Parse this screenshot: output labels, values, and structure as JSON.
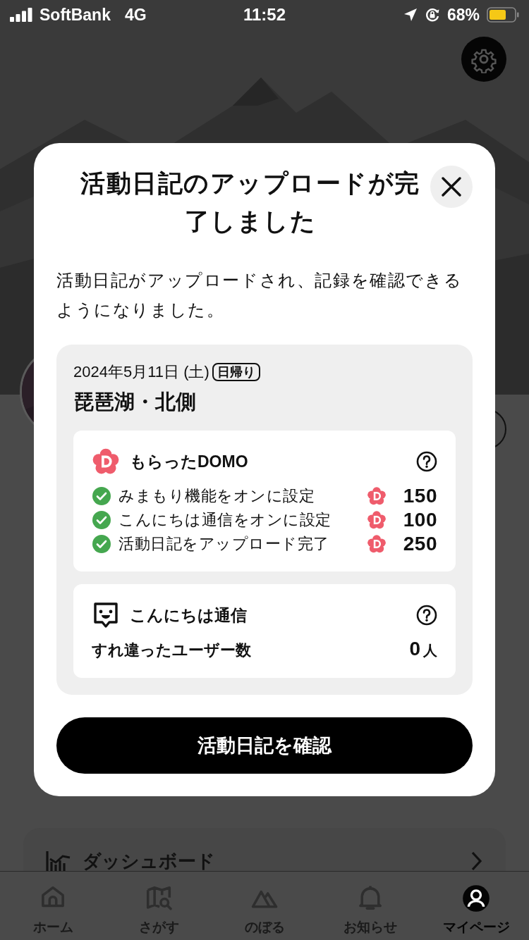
{
  "status_bar": {
    "carrier": "SoftBank",
    "network": "4G",
    "time": "11:52",
    "battery": "68%"
  },
  "background": {
    "dashboard_label": "ダッシュボード"
  },
  "dialog": {
    "title": "活動日記のアップロードが完了しました",
    "message": "活動日記がアップロードされ、記録を確認できるようになりました。",
    "summary": {
      "date": "2024年5月11日 (土)",
      "trip_type": "日帰り",
      "place": "琵琶湖・北側",
      "domo": {
        "title": "もらったDOMO",
        "items": [
          {
            "label": "みまもり機能をオンに設定",
            "checked": true,
            "points": "150"
          },
          {
            "label": "こんにちは通信をオンに設定",
            "checked": true,
            "points": "100"
          },
          {
            "label": "活動日記をアップロード完了",
            "checked": true,
            "points": "250"
          }
        ]
      },
      "encounter": {
        "title": "こんにちは通信",
        "label": "すれ違ったユーザー数",
        "count": "0",
        "unit": "人"
      }
    },
    "button": "活動日記を確認"
  },
  "tab_bar": [
    {
      "label": "ホーム",
      "kind": "home",
      "selected": false
    },
    {
      "label": "さがす",
      "kind": "map",
      "selected": false
    },
    {
      "label": "のぼる",
      "kind": "mountain",
      "selected": false
    },
    {
      "label": "お知らせ",
      "kind": "bell",
      "selected": false
    },
    {
      "label": "マイページ",
      "kind": "person",
      "selected": true
    }
  ]
}
